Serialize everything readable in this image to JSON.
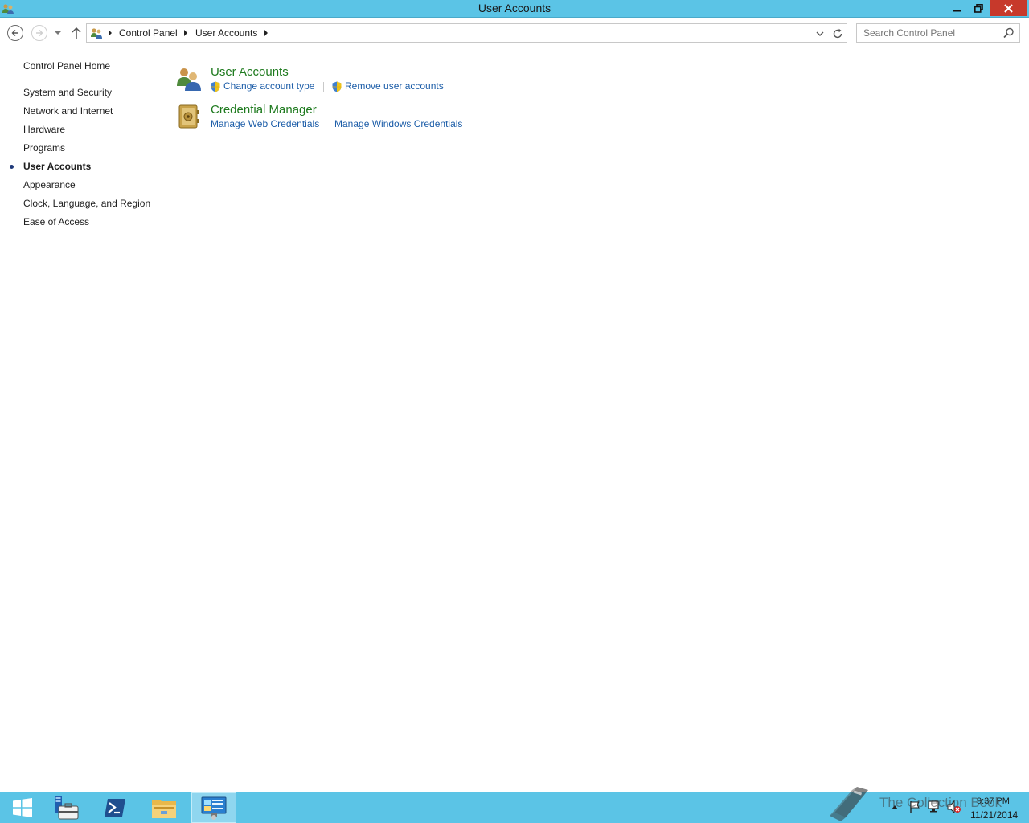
{
  "window": {
    "title": "User Accounts",
    "controls": {
      "minimize": "minimize",
      "restore": "restore",
      "close": "close"
    }
  },
  "navigation": {
    "breadcrumb": [
      "Control Panel",
      "User Accounts"
    ],
    "search_placeholder": "Search Control Panel"
  },
  "sidebar": {
    "home": "Control Panel Home",
    "items": [
      {
        "label": "System and Security",
        "active": false
      },
      {
        "label": "Network and Internet",
        "active": false
      },
      {
        "label": "Hardware",
        "active": false
      },
      {
        "label": "Programs",
        "active": false
      },
      {
        "label": "User Accounts",
        "active": true
      },
      {
        "label": "Appearance",
        "active": false
      },
      {
        "label": "Clock, Language, and Region",
        "active": false
      },
      {
        "label": "Ease of Access",
        "active": false
      }
    ]
  },
  "sections": [
    {
      "title": "User Accounts",
      "icon": "user-accounts-icon",
      "links": [
        {
          "label": "Change account type",
          "shield": true
        },
        {
          "label": "Remove user accounts",
          "shield": true
        }
      ]
    },
    {
      "title": "Credential Manager",
      "icon": "credential-manager-icon",
      "links": [
        {
          "label": "Manage Web Credentials",
          "shield": false
        },
        {
          "label": "Manage Windows Credentials",
          "shield": false
        }
      ]
    }
  ],
  "taskbar": {
    "apps": [
      "start-icon",
      "server-manager-icon",
      "powershell-icon",
      "file-explorer-icon",
      "control-panel-icon"
    ],
    "active_app": "control-panel-icon",
    "time": "9:37 PM",
    "date": "11/21/2014"
  },
  "watermark": {
    "text": "The Collection Book"
  },
  "colors": {
    "titlebar": "#5bc4e6",
    "taskbar": "#5bc4e6",
    "close_button": "#c7392b",
    "section_title": "#1e7a1e",
    "link": "#1c5da8"
  }
}
